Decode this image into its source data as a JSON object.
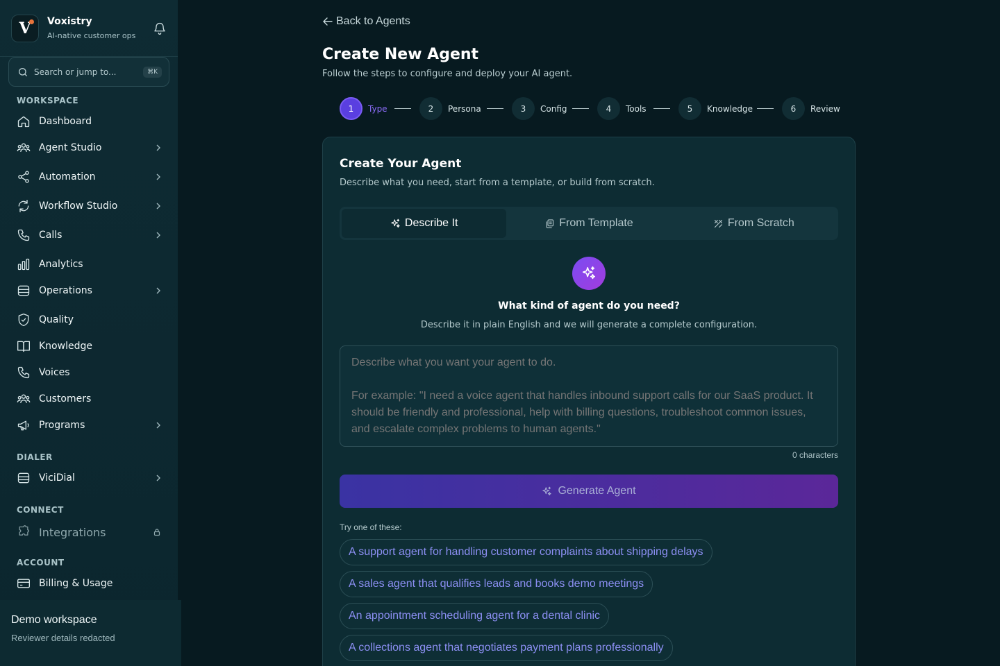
{
  "brand": {
    "name": "Voxistry",
    "tagline": "AI-native customer ops",
    "logo_letter": "V",
    "accent": "#e8743b"
  },
  "search": {
    "placeholder": "Search or jump to...",
    "shortcut": "⌘K"
  },
  "sidebar": {
    "sections": {
      "workspace": "WORKSPACE",
      "dialer": "DIALER",
      "connect": "CONNECT",
      "account": "ACCOUNT"
    },
    "items": [
      {
        "label": "Dashboard",
        "icon": "home-icon"
      },
      {
        "label": "Agent Studio",
        "icon": "users-icon",
        "expandable": true
      },
      {
        "label": "Automation",
        "icon": "share-icon",
        "expandable": true
      },
      {
        "label": "Workflow Studio",
        "icon": "refresh-icon",
        "expandable": true
      },
      {
        "label": "Calls",
        "icon": "phone-icon",
        "expandable": true
      },
      {
        "label": "Analytics",
        "icon": "bar-chart-icon"
      },
      {
        "label": "Operations",
        "icon": "database-icon",
        "expandable": true
      },
      {
        "label": "Quality",
        "icon": "shield-check-icon"
      },
      {
        "label": "Knowledge",
        "icon": "book-icon"
      },
      {
        "label": "Voices",
        "icon": "phone-icon"
      },
      {
        "label": "Customers",
        "icon": "users-icon"
      },
      {
        "label": "Programs",
        "icon": "megaphone-icon",
        "expandable": true
      },
      {
        "label": "ViciDial",
        "icon": "server-icon",
        "expandable": true
      },
      {
        "label": "Integrations",
        "icon": "puzzle-icon",
        "locked": true
      },
      {
        "label": "Billing & Usage",
        "icon": "credit-card-icon"
      }
    ]
  },
  "footer": {
    "workspace": "Demo workspace",
    "details": "Reviewer details redacted"
  },
  "main": {
    "back_label": "Back to Agents",
    "title": "Create New Agent",
    "subtitle": "Follow the steps to configure and deploy your AI agent.",
    "steps": [
      {
        "num": "1",
        "label": "Type"
      },
      {
        "num": "2",
        "label": "Persona"
      },
      {
        "num": "3",
        "label": "Config"
      },
      {
        "num": "4",
        "label": "Tools"
      },
      {
        "num": "5",
        "label": "Knowledge"
      },
      {
        "num": "6",
        "label": "Review"
      }
    ],
    "active_step": 1
  },
  "card": {
    "title": "Create Your Agent",
    "subtitle": "Describe what you need, start from a template, or build from scratch.",
    "tabs": [
      "Describe It",
      "From Template",
      "From Scratch"
    ],
    "active_tab": "Describe It",
    "question": "What kind of agent do you need?",
    "question_sub": "Describe it in plain English and we will generate a complete configuration.",
    "textarea_placeholder": "Describe what you want your agent to do.\n\nFor example: \"I need a voice agent that handles inbound support calls for our SaaS product. It should be friendly and professional, help with billing questions, troubleshoot common issues, and escalate complex problems to human agents.\"",
    "textarea_value": "",
    "char_count": "0 characters",
    "generate_label": "Generate Agent",
    "try_label": "Try one of these:",
    "suggestions": [
      "A support agent for handling customer complaints about shipping delays",
      "A sales agent that qualifies leads and books demo meetings",
      "An appointment scheduling agent for a dental clinic",
      "A collections agent that negotiates payment plans professionally"
    ]
  },
  "colors": {
    "background": "#071a20",
    "sidebar": "#0e2b33",
    "card": "#0d2c33",
    "primary": "#5a3fe0",
    "suggestion_text": "#8c8ff3"
  }
}
